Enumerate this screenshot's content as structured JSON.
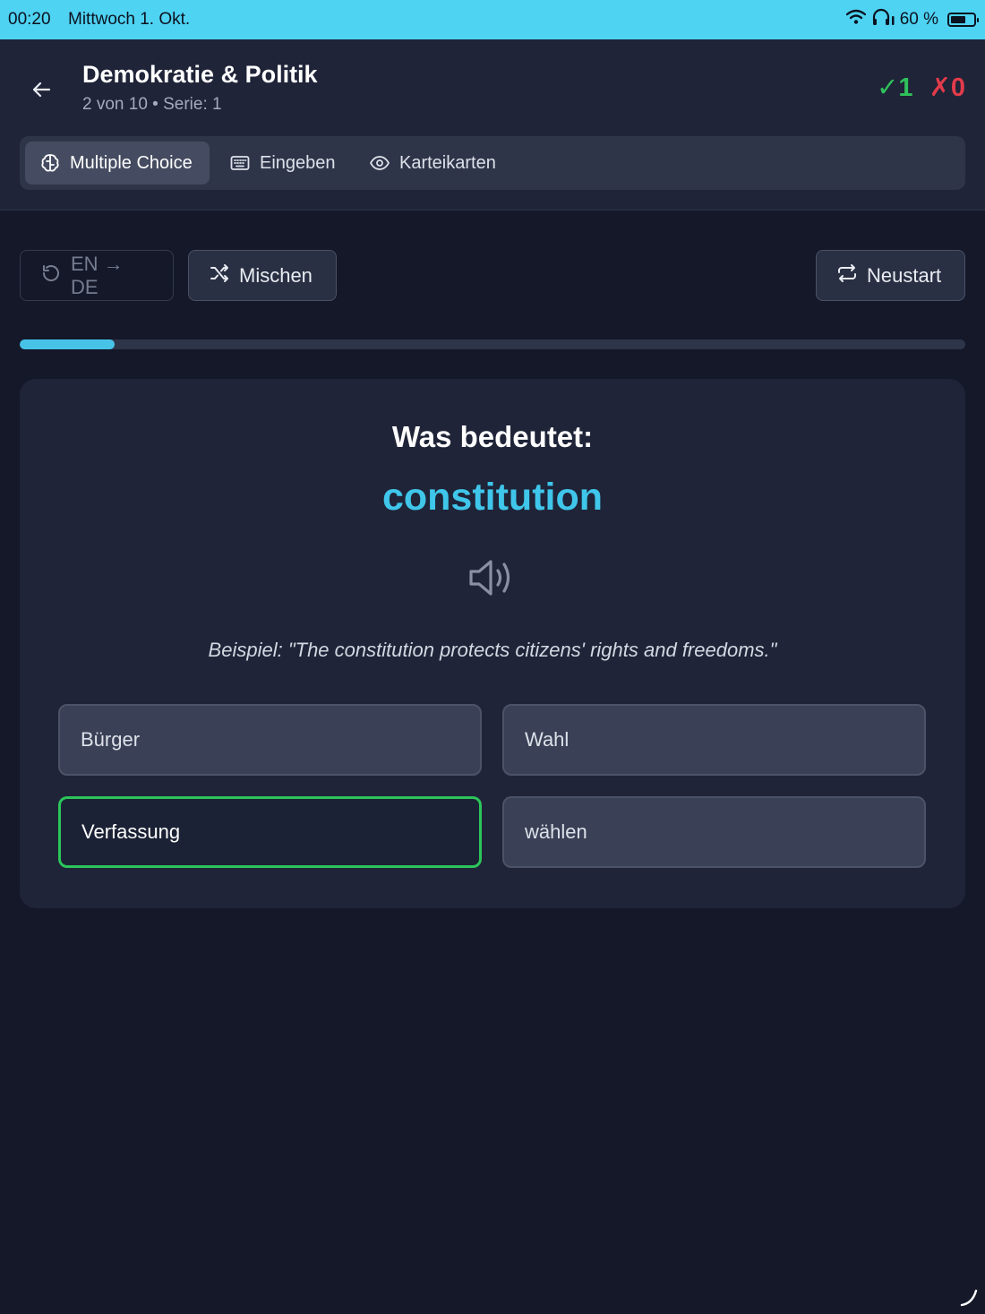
{
  "status": {
    "time": "00:20",
    "date": "Mittwoch 1. Okt.",
    "battery_text": "60 %",
    "icons": [
      "wifi-icon",
      "headphones-icon",
      "battery-icon"
    ]
  },
  "header": {
    "title": "Demokratie & Politik",
    "subtitle": "2 von 10 • Serie: 1",
    "correct_count": "✓1",
    "wrong_count": "✗0"
  },
  "modes": [
    {
      "label": "Multiple Choice",
      "icon": "brain-icon",
      "active": true
    },
    {
      "label": "Eingeben",
      "icon": "keyboard-icon",
      "active": false
    },
    {
      "label": "Karteikarten",
      "icon": "eye-icon",
      "active": false
    }
  ],
  "controls": {
    "direction": "EN → DE",
    "shuffle": "Mischen",
    "restart": "Neustart"
  },
  "progress": {
    "fraction": 0.1
  },
  "card": {
    "question": "Was bedeutet:",
    "word": "constitution",
    "example": "Beispiel: \"The constitution protects citizens' rights and freedoms.\"",
    "options": [
      "Bürger",
      "Wahl",
      "Verfassung",
      "wählen"
    ],
    "correct_option": "Verfassung"
  },
  "colors": {
    "accent": "#3fc6ea",
    "correct": "#2cc55a",
    "wrong": "#e23b4a",
    "statusbar": "#4fd3f2",
    "background": "#141829"
  }
}
